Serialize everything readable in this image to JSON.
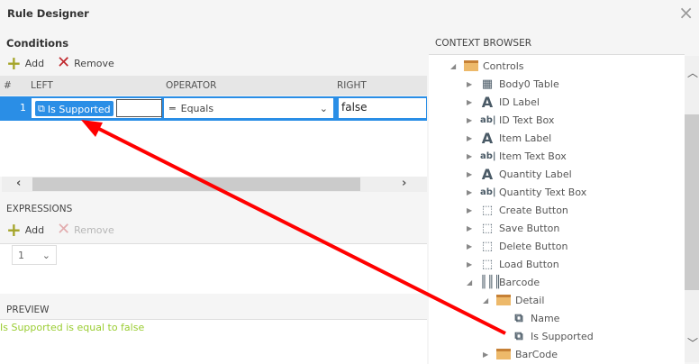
{
  "window": {
    "title": "Rule Designer",
    "close": "×"
  },
  "conditions": {
    "title": "Conditions",
    "add": "Add",
    "remove": "Remove",
    "columns": [
      "#",
      "LEFT",
      "OPERATOR",
      "RIGHT"
    ],
    "row": {
      "index": "1",
      "left": "Is Supported",
      "operator": "Equals",
      "right": "false"
    }
  },
  "expressions": {
    "title": "EXPRESSIONS",
    "add": "Add",
    "remove": "Remove",
    "select": "1"
  },
  "preview": {
    "title": "PREVIEW",
    "text": "Is Supported is equal to false"
  },
  "context": {
    "title": "CONTEXT BROWSER",
    "items": [
      {
        "label": "Controls",
        "icon": "folder-icon"
      },
      {
        "label": "Body0 Table",
        "icon": "table-icon"
      },
      {
        "label": "ID Label",
        "icon": "label-icon"
      },
      {
        "label": "ID Text Box",
        "icon": "textbox-icon"
      },
      {
        "label": "Item Label",
        "icon": "label-icon"
      },
      {
        "label": "Item Text Box",
        "icon": "textbox-icon"
      },
      {
        "label": "Quantity Label",
        "icon": "label-icon"
      },
      {
        "label": "Quantity Text Box",
        "icon": "textbox-icon"
      },
      {
        "label": "Create Button",
        "icon": "button-icon"
      },
      {
        "label": "Save Button",
        "icon": "button-icon"
      },
      {
        "label": "Delete Button",
        "icon": "button-icon"
      },
      {
        "label": "Load Button",
        "icon": "button-icon"
      },
      {
        "label": "Barcode",
        "icon": "barcode-icon"
      },
      {
        "label": "Detail",
        "icon": "folder-icon"
      },
      {
        "label": "Name",
        "icon": "property-icon"
      },
      {
        "label": "Is Supported",
        "icon": "property-icon"
      },
      {
        "label": "BarCode",
        "icon": "folder-icon"
      }
    ]
  },
  "colors": {
    "accent": "#2a8ee6",
    "preview": "#9acd32",
    "arrow": "#ff0000"
  }
}
